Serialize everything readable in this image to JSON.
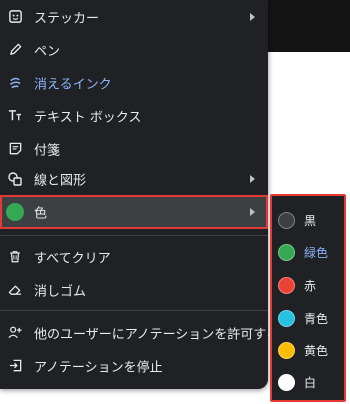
{
  "menu": {
    "items": [
      {
        "label": "ステッカー",
        "icon": "sticker-icon",
        "has_submenu": true
      },
      {
        "label": "ペン",
        "icon": "pen-icon",
        "has_submenu": false
      },
      {
        "label": "消えるインク",
        "icon": "disappearing-ink-icon",
        "has_submenu": false,
        "active": true
      },
      {
        "label": "テキスト ボックス",
        "icon": "text-box-icon",
        "has_submenu": false
      },
      {
        "label": "付箋",
        "icon": "sticky-note-icon",
        "has_submenu": false
      },
      {
        "label": "線と図形",
        "icon": "shapes-icon",
        "has_submenu": true
      },
      {
        "label": "色",
        "icon": "color-dot-icon",
        "has_submenu": true,
        "selected": true
      },
      {
        "label": "すべてクリア",
        "icon": "trash-icon",
        "has_submenu": false
      },
      {
        "label": "消しゴム",
        "icon": "eraser-icon",
        "has_submenu": false
      },
      {
        "label": "他のユーザーにアノテーションを許可する",
        "icon": "add-person-icon",
        "has_submenu": false
      },
      {
        "label": "アノテーションを停止",
        "icon": "exit-icon",
        "has_submenu": false
      }
    ],
    "selected_color": "#34a853"
  },
  "palette": {
    "colors": [
      {
        "name": "黒",
        "hex": "#3c4043"
      },
      {
        "name": "緑色",
        "hex": "#34a853",
        "selected": true
      },
      {
        "name": "赤",
        "hex": "#ea4335"
      },
      {
        "name": "青色",
        "hex": "#24c1e0"
      },
      {
        "name": "黄色",
        "hex": "#fbbc04"
      },
      {
        "name": "白",
        "hex": "#ffffff"
      }
    ]
  },
  "colors": {
    "menu_bg": "#202124",
    "highlight_border": "#e53935",
    "accent_text": "#8ab4f8"
  }
}
